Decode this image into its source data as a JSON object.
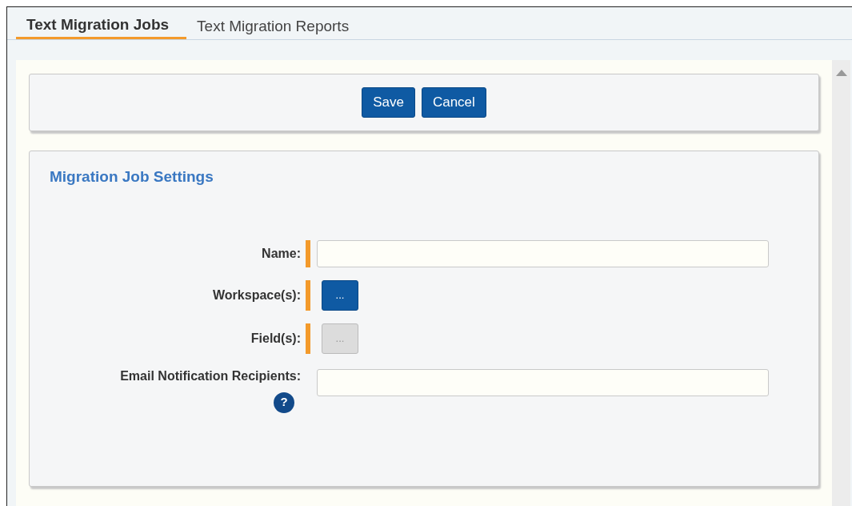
{
  "tabs": [
    {
      "label": "Text Migration Jobs",
      "selected": true
    },
    {
      "label": "Text Migration Reports",
      "selected": false
    }
  ],
  "toolbar": {
    "buttons": [
      "Save",
      "Cancel"
    ]
  },
  "settings": {
    "title": "Migration Job Settings",
    "fields": [
      {
        "kind": "text",
        "label": "Name:",
        "required": true
      },
      {
        "kind": "button",
        "label": "Workspace(s):",
        "required": true,
        "button_label": "...",
        "disabled": false
      },
      {
        "kind": "button",
        "label": "Field(s):",
        "required": true,
        "button_label": "...",
        "disabled": true
      },
      {
        "kind": "text",
        "label": "Email Notification Recipients:",
        "required": false,
        "help": "?"
      }
    ]
  }
}
